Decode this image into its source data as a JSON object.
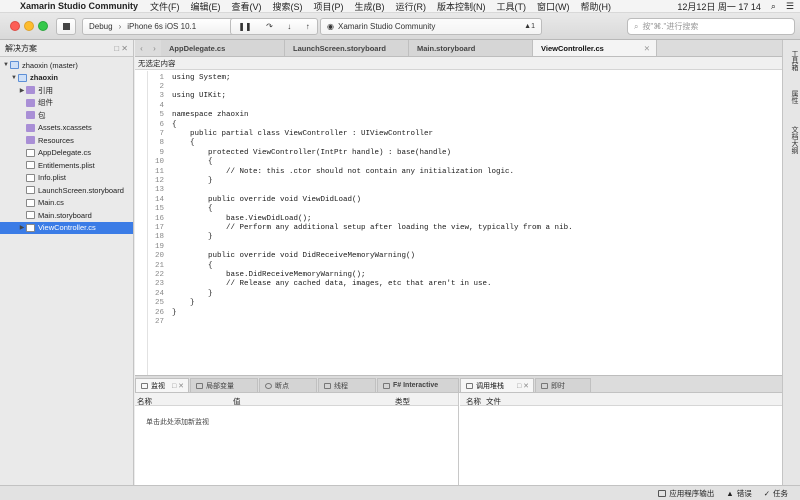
{
  "menubar": {
    "apple": "",
    "app_name": "Xamarin Studio Community",
    "items": [
      "文件(F)",
      "编辑(E)",
      "查看(V)",
      "搜索(S)",
      "项目(P)",
      "生成(B)",
      "运行(R)",
      "版本控制(N)",
      "工具(T)",
      "窗口(W)",
      "帮助(H)"
    ],
    "clock": "12月12日 周一 17 14"
  },
  "toolbar": {
    "config": "Debug",
    "sep": "›",
    "device": "iPhone 6s iOS 10.1",
    "debug_glyphs": [
      "❚❚",
      "↷",
      "↓",
      "↑"
    ],
    "status_text": "Xamarin Studio Community",
    "warning_count": "▲1",
    "search_placeholder": "按\"⌘.\"进行搜索"
  },
  "sidebar": {
    "title": "解决方案",
    "controls": "□ ✕",
    "items": [
      {
        "label": "zhaoxin (master)",
        "arrow": "▼",
        "icon": "solution-icon",
        "level": 0
      },
      {
        "label": "zhaoxin",
        "arrow": "▼",
        "icon": "project-icon",
        "level": 1,
        "bold": true
      },
      {
        "label": "引用",
        "arrow": "▶",
        "icon": "folder-icon",
        "level": 2
      },
      {
        "label": "组件",
        "arrow": "",
        "icon": "folder-icon",
        "level": 2
      },
      {
        "label": "包",
        "arrow": "",
        "icon": "folder-icon",
        "level": 2
      },
      {
        "label": "Assets.xcassets",
        "arrow": "",
        "icon": "folder-icon",
        "level": 2
      },
      {
        "label": "Resources",
        "arrow": "",
        "icon": "folder-icon",
        "level": 2
      },
      {
        "label": "AppDelegate.cs",
        "arrow": "",
        "icon": "file-icon",
        "level": 2
      },
      {
        "label": "Entitlements.plist",
        "arrow": "",
        "icon": "file-icon",
        "level": 2
      },
      {
        "label": "Info.plist",
        "arrow": "",
        "icon": "file-icon",
        "level": 2
      },
      {
        "label": "LaunchScreen.storyboard",
        "arrow": "",
        "icon": "file-icon",
        "level": 2
      },
      {
        "label": "Main.cs",
        "arrow": "",
        "icon": "file-icon",
        "level": 2
      },
      {
        "label": "Main.storyboard",
        "arrow": "",
        "icon": "file-icon",
        "level": 2
      },
      {
        "label": "ViewController.cs",
        "arrow": "▶",
        "icon": "file-icon",
        "level": 2,
        "selected": true
      }
    ]
  },
  "editor": {
    "nav_back": "‹",
    "nav_fwd": "›",
    "tabs": [
      {
        "label": "AppDelegate.cs",
        "active": false
      },
      {
        "label": "LaunchScreen.storyboard",
        "active": false
      },
      {
        "label": "Main.storyboard",
        "active": false
      },
      {
        "label": "ViewController.cs",
        "active": true,
        "close": "✕"
      }
    ],
    "breadcrumb": "无选定内容",
    "code_lines": [
      "using System;",
      "",
      "using UIKit;",
      "",
      "namespace zhaoxin",
      "{",
      "    public partial class ViewController : UIViewController",
      "    {",
      "        protected ViewController(IntPtr handle) : base(handle)",
      "        {",
      "            // Note: this .ctor should not contain any initialization logic.",
      "        }",
      "",
      "        public override void ViewDidLoad()",
      "        {",
      "            base.ViewDidLoad();",
      "            // Perform any additional setup after loading the view, typically from a nib.",
      "        }",
      "",
      "        public override void DidReceiveMemoryWarning()",
      "        {",
      "            base.DidReceiveMemoryWarning();",
      "            // Release any cached data, images, etc that aren't in use.",
      "        }",
      "    }",
      "}",
      ""
    ]
  },
  "right_rail": [
    "工具箱",
    "属性",
    "文档大纲"
  ],
  "pads": {
    "tabs": [
      {
        "label": "监视",
        "active": true,
        "close": "□ ✕"
      },
      {
        "label": "局部变量",
        "active": false
      },
      {
        "label": "断点",
        "active": false
      },
      {
        "label": "线程",
        "active": false
      },
      {
        "label": "F# Interactive",
        "active": false
      },
      {
        "label": "调用堆栈",
        "active": true,
        "close": "□ ✕"
      },
      {
        "label": "即时",
        "active": false
      }
    ],
    "watch": {
      "col_name": "名称",
      "col_value": "值",
      "col_type": "类型",
      "hint": "单击此处添加新监视"
    },
    "stack": {
      "col_name": "名称",
      "col_file": "文件"
    }
  },
  "statusbar": {
    "items": [
      "应用程序输出",
      "错误",
      "任务"
    ]
  },
  "colors": {
    "selection": "#3b7ce6",
    "folder": "#a98fd6",
    "close": "#fc5f57",
    "minimize": "#fdbc2e",
    "maximize": "#34c84a"
  }
}
